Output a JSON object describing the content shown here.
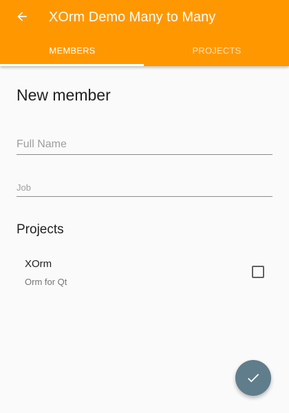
{
  "appbar": {
    "title": "XOrm Demo Many to Many",
    "back_icon": "arrow-left-icon",
    "color": "#ff9800"
  },
  "tabs": [
    {
      "label": "MEMBERS",
      "active": true
    },
    {
      "label": "PROJECTS",
      "active": false
    }
  ],
  "form": {
    "heading": "New member",
    "full_name": {
      "value": "",
      "placeholder": "Full Name"
    },
    "job": {
      "value": "",
      "placeholder": "Job"
    }
  },
  "projects": {
    "title": "Projects",
    "items": [
      {
        "name": "XOrm",
        "description": "Orm for Qt",
        "checked": false
      }
    ]
  },
  "fab": {
    "icon": "check-icon",
    "color": "#607d8b"
  }
}
